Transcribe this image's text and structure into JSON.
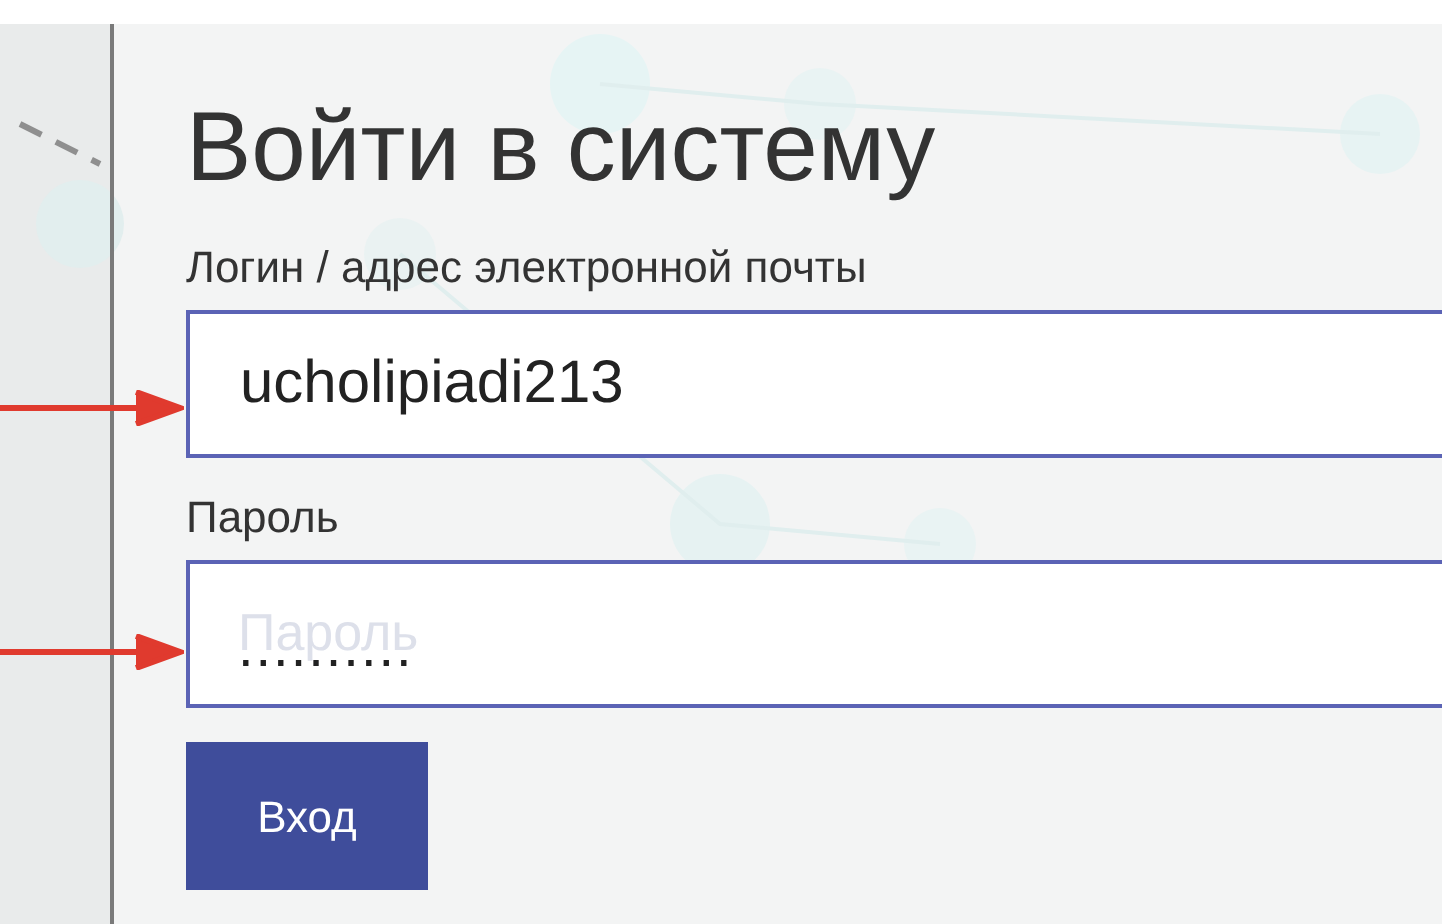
{
  "title": "Войти в систему",
  "login": {
    "label": "Логин / адрес электронной почты",
    "value": "ucholipiadi213"
  },
  "password": {
    "label": "Пароль",
    "placeholder": "Пароль",
    "value": ".........."
  },
  "submit_button": "Вход"
}
